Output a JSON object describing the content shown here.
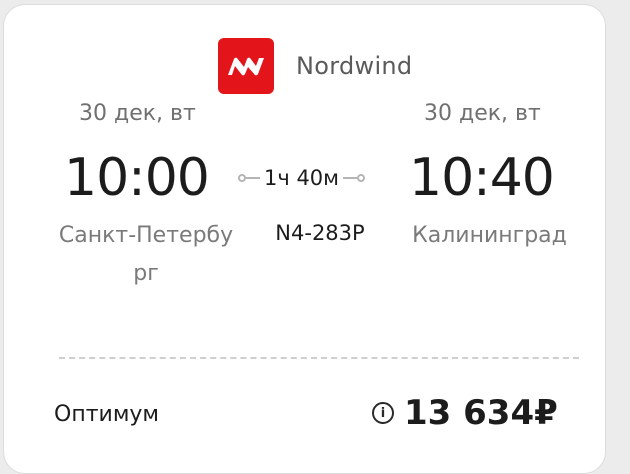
{
  "airline": {
    "name": "Nordwind",
    "logo_color": "#e4141b",
    "logo_icon": "nordwind-logo"
  },
  "departure": {
    "date": "30 дек, вт",
    "time": "10:00",
    "city": "Санкт-Петербург"
  },
  "arrival": {
    "date": "30 дек, вт",
    "time": "10:40",
    "city": "Калининград"
  },
  "flight": {
    "duration": "1ч 40м",
    "number": "N4-283P"
  },
  "fare": {
    "name": "Оптимум",
    "price": "13 634₽",
    "info_icon": "info-icon"
  }
}
